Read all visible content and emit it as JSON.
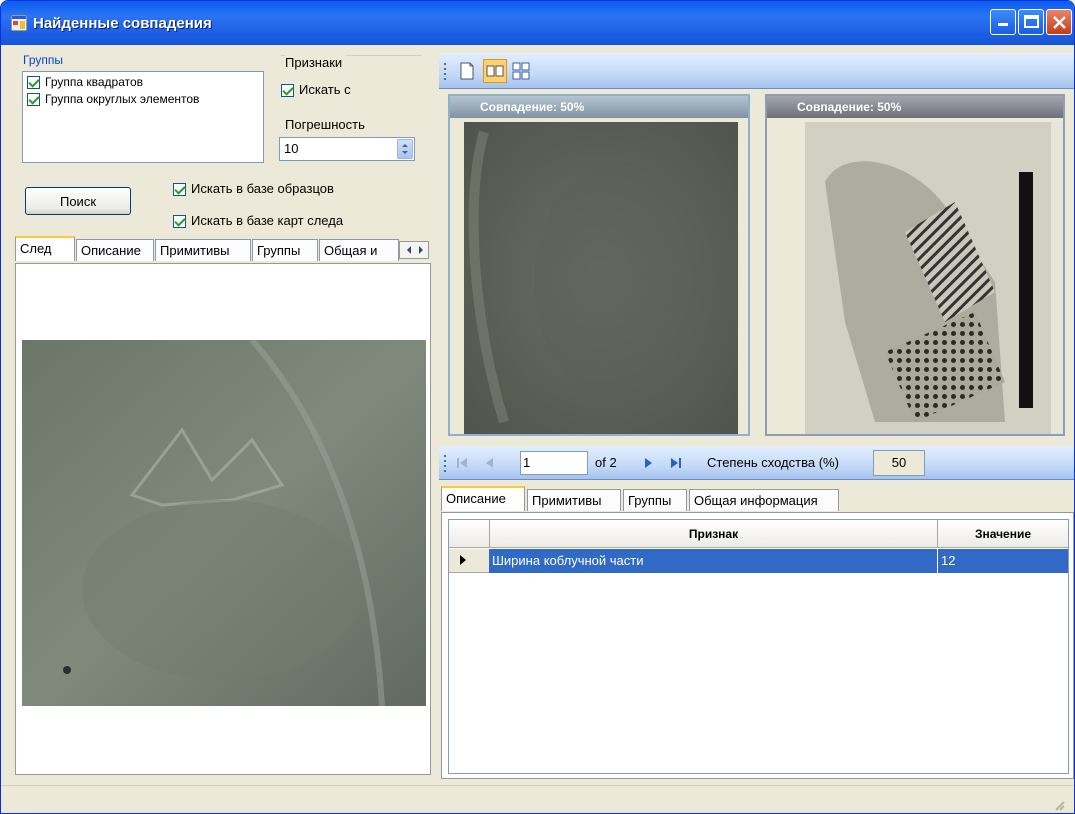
{
  "window": {
    "title": "Найденные совпадения"
  },
  "groups": {
    "title": "Группы",
    "items": [
      {
        "label": "Группа квадратов",
        "checked": true
      },
      {
        "label": "Группа округлых элементов",
        "checked": true
      }
    ]
  },
  "features": {
    "title": "Признаки",
    "search_with_label": "Искать с",
    "tolerance_label": "Погрешность",
    "tolerance_value": "10"
  },
  "search": {
    "button_label": "Поиск",
    "search_samples_label": "Искать в базе образцов",
    "search_trace_cards_label": "Искать в базе карт следа"
  },
  "left_tabs": [
    "След",
    "Описание",
    "Примитивы",
    "Группы",
    "Общая и"
  ],
  "image_panels": [
    {
      "header": "Совпадение: 50%"
    },
    {
      "header": "Совпадение: 50%"
    }
  ],
  "navigator": {
    "current_page": "1",
    "of_label": "of 2",
    "similarity_label": "Степень сходства (%)",
    "similarity_value": "50"
  },
  "right_tabs": [
    "Описание",
    "Примитивы",
    "Группы",
    "Общая информация"
  ],
  "grid": {
    "columns": [
      "Признак",
      "Значение"
    ],
    "rows": [
      {
        "feature": "Ширина коблучной части",
        "value": "12"
      }
    ]
  }
}
